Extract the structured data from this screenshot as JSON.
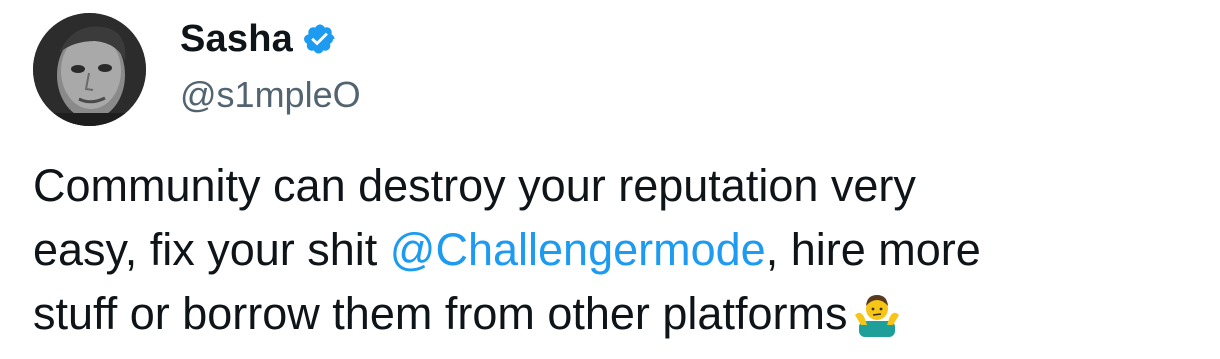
{
  "tweet": {
    "author": {
      "display_name": "Sasha",
      "handle": "@s1mpleO",
      "verified": true
    },
    "body": {
      "line1": "Community can destroy your reputation very",
      "line2_before": "easy, fix your shit ",
      "mention": "@Challengermode",
      "line2_after": ", hire more",
      "line3": "stuff or borrow them from other platforms",
      "emoji": "person-shrugging"
    }
  },
  "colors": {
    "text": "#0f1419",
    "secondary": "#536471",
    "accent": "#1d9bf0"
  }
}
